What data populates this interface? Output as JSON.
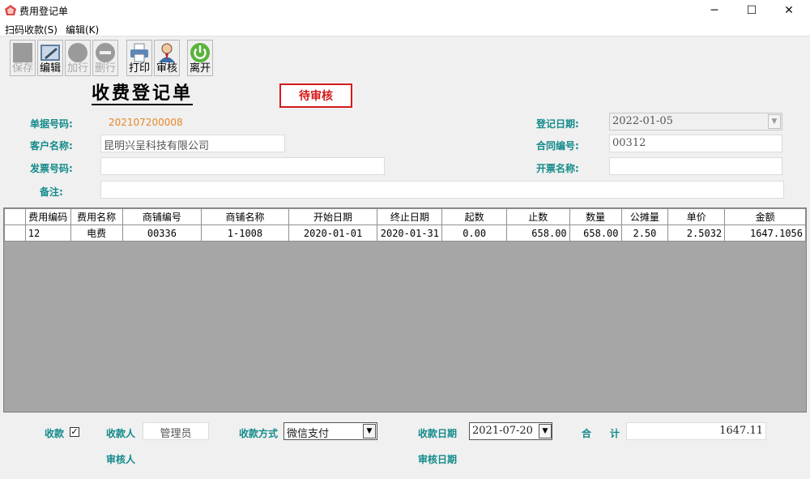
{
  "window": {
    "title": "费用登记单",
    "minimize_glyph": "─",
    "maximize_glyph": "☐",
    "close_glyph": "✕"
  },
  "menu": {
    "items": [
      "扫码收款(S)",
      "编辑(K)"
    ]
  },
  "toolbar": {
    "buttons": [
      {
        "label": "保存",
        "icon": "save-icon",
        "enabled": false
      },
      {
        "label": "编辑",
        "icon": "edit-icon",
        "enabled": true
      },
      {
        "label": "加行",
        "icon": "add-row-icon",
        "enabled": false
      },
      {
        "label": "删行",
        "icon": "delete-row-icon",
        "enabled": false
      },
      {
        "label": "打印",
        "icon": "printer-icon",
        "enabled": true
      },
      {
        "label": "审核",
        "icon": "auditor-icon",
        "enabled": true
      },
      {
        "label": "离开",
        "icon": "power-icon",
        "enabled": true
      }
    ]
  },
  "form": {
    "title": "收费登记单",
    "status": "待审核",
    "doc_no_label": "单据号码:",
    "doc_no": "202107200008",
    "customer_label": "客户名称:",
    "customer": "昆明兴呈科技有限公司",
    "invoice_no_label": "发票号码:",
    "invoice_no": "",
    "remark_label": "备注:",
    "remark": "",
    "reg_date_label": "登记日期:",
    "reg_date": "2022-01-05",
    "contract_label": "合同编号:",
    "contract": "00312",
    "invoice_name_label": "开票名称:",
    "invoice_name": ""
  },
  "grid": {
    "headers": [
      "费用编码",
      "费用名称",
      "商铺编号",
      "商铺名称",
      "开始日期",
      "终止日期",
      "起数",
      "止数",
      "数量",
      "公摊量",
      "单价",
      "金额"
    ],
    "rows": [
      [
        "12",
        "电费",
        "00336",
        "1-1008",
        "2020-01-01",
        "2020-01-31",
        "0.00",
        "658.00",
        "658.00",
        "2.50",
        "2.5032",
        "1647.1056"
      ]
    ]
  },
  "footer": {
    "collect_label": "收款",
    "collect_checked": true,
    "collector_label": "收款人",
    "collector": "管理员",
    "method_label": "收款方式",
    "method": "微信支付",
    "collect_date_label": "收款日期",
    "collect_date": "2021-07-20",
    "total_label_1": "合",
    "total_label_2": "计",
    "total": "1647.11",
    "auditor_label": "审核人",
    "audit_date_label": "审核日期"
  },
  "colors": {
    "label_teal": "#138a8a",
    "doc_no_orange": "#e8862a",
    "status_red": "#d41a1a",
    "grid_empty": "#a6a6a6"
  }
}
